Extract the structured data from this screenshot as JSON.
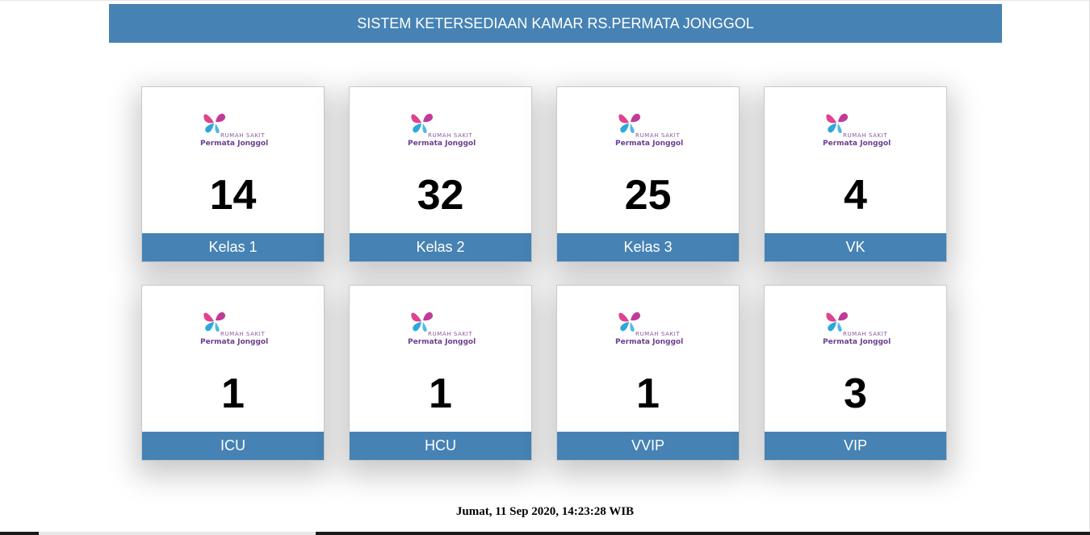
{
  "header": {
    "title": "SISTEM KETERSEDIAAN KAMAR RS.PERMATA JONGGOL"
  },
  "logo": {
    "line1": "RUMAH SAKIT",
    "line2": "Permata Jonggol"
  },
  "rooms": [
    {
      "count": "14",
      "label": "Kelas 1"
    },
    {
      "count": "32",
      "label": "Kelas 2"
    },
    {
      "count": "25",
      "label": "Kelas 3"
    },
    {
      "count": "4",
      "label": "VK"
    },
    {
      "count": "1",
      "label": "ICU"
    },
    {
      "count": "1",
      "label": "HCU"
    },
    {
      "count": "1",
      "label": "VVIP"
    },
    {
      "count": "3",
      "label": "VIP"
    }
  ],
  "footer": {
    "datetime": "Jumat, 11 Sep 2020, 14:23:28 WIB"
  },
  "colors": {
    "accent": "#4682b4",
    "logo_pink": "#e0428f",
    "logo_blue": "#2ea8d8",
    "logo_purple": "#6a3f8f"
  }
}
